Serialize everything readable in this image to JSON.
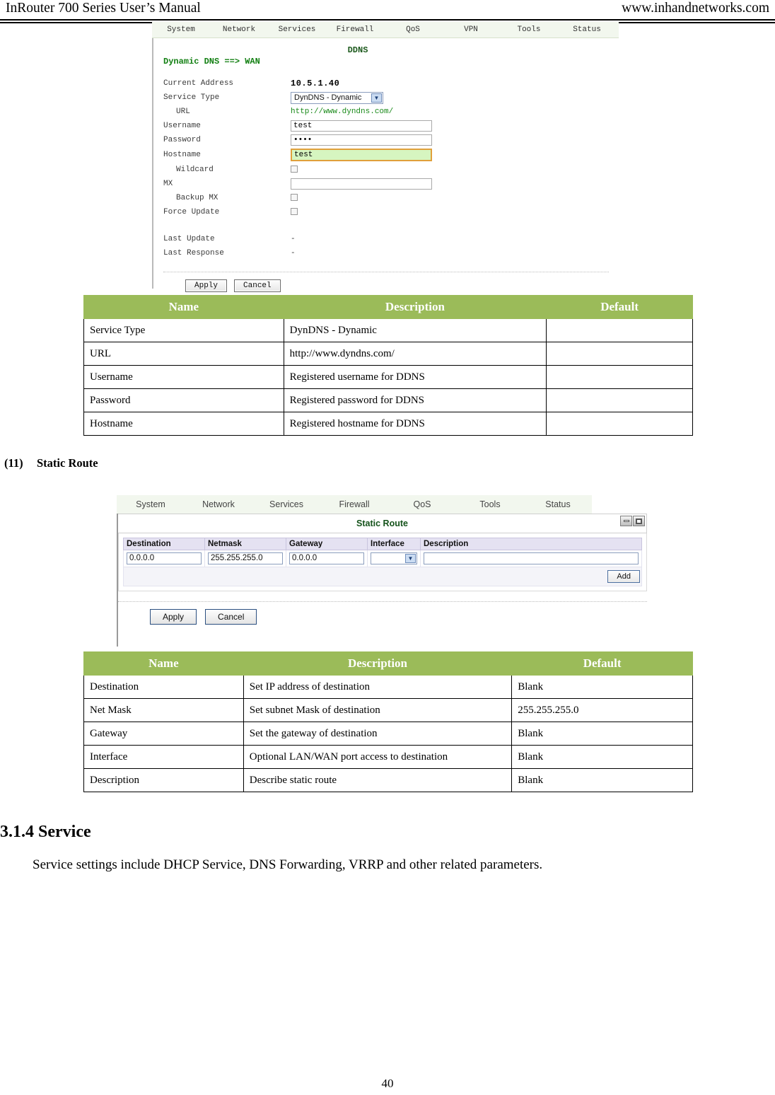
{
  "header": {
    "left": "InRouter 700 Series User’s Manual",
    "right": "www.inhandnetworks.com"
  },
  "ddns_screenshot": {
    "nav": [
      "System",
      "Network",
      "Services",
      "Firewall",
      "QoS",
      "VPN",
      "Tools",
      "Status"
    ],
    "panel_title": "DDNS",
    "subtitle": "Dynamic DNS ==> WAN",
    "fields": {
      "current_address_label": "Current Address",
      "current_address_value": "10.5.1.40",
      "service_type_label": "Service Type",
      "service_type_value": "DynDNS - Dynamic",
      "url_label": "URL",
      "url_value": "http://www.dyndns.com/",
      "username_label": "Username",
      "username_value": "test",
      "password_label": "Password",
      "password_value": "••••",
      "hostname_label": "Hostname",
      "hostname_value": "test",
      "wildcard_label": "Wildcard",
      "mx_label": "MX",
      "mx_value": "",
      "backup_mx_label": "Backup MX",
      "force_update_label": "Force Update",
      "last_update_label": "Last Update",
      "last_update_value": "-",
      "last_response_label": "Last Response",
      "last_response_value": "-"
    },
    "buttons": {
      "apply": "Apply",
      "cancel": "Cancel"
    }
  },
  "ddns_table": {
    "columns": [
      "Name",
      "Description",
      "Default"
    ],
    "rows": [
      [
        "Service Type",
        "DynDNS - Dynamic",
        ""
      ],
      [
        "URL",
        "http://www.dyndns.com/",
        ""
      ],
      [
        "Username",
        "Registered username for DDNS",
        ""
      ],
      [
        "Password",
        "Registered password for DDNS",
        ""
      ],
      [
        "Hostname",
        "Registered hostname for DDNS",
        ""
      ]
    ]
  },
  "static_route_heading": {
    "number": "(11)",
    "text": "Static Route"
  },
  "static_route_screenshot": {
    "nav": [
      "System",
      "Network",
      "Services",
      "Firewall",
      "QoS",
      "Tools",
      "Status"
    ],
    "panel_title": "Static Route",
    "window_buttons": [
      "minimize-icon",
      "maximize-icon"
    ],
    "columns": [
      "Destination",
      "Netmask",
      "Gateway",
      "Interface",
      "Description"
    ],
    "values": {
      "destination": "0.0.0.0",
      "netmask": "255.255.255.0",
      "gateway": "0.0.0.0",
      "interface": "",
      "description": ""
    },
    "add_button": "Add",
    "buttons": {
      "apply": "Apply",
      "cancel": "Cancel"
    }
  },
  "static_route_table": {
    "columns": [
      "Name",
      "Description",
      "Default"
    ],
    "rows": [
      [
        "Destination",
        "Set IP address of destination",
        "Blank"
      ],
      [
        "Net Mask",
        "Set subnet Mask of destination",
        "255.255.255.0"
      ],
      [
        "Gateway",
        "Set the gateway of destination",
        "Blank"
      ],
      [
        "Interface",
        "Optional LAN/WAN port access to destination",
        "Blank"
      ],
      [
        "Description",
        "Describe static route",
        "Blank"
      ]
    ]
  },
  "section": {
    "heading": "3.1.4 Service",
    "paragraph": "Service settings include DHCP Service, DNS Forwarding, VRRP and other related parameters."
  },
  "page_number": "40",
  "colors": {
    "table_header_green": "#9BBB59",
    "ui_nav_bg": "#f2f7ee",
    "panel_title_green": "#14521a",
    "link_green": "#1a8a1a",
    "highlight_field_bg": "#d6f5c0",
    "highlight_field_border": "#e0a03b",
    "sr_header_lavender": "#e5e2f2"
  }
}
